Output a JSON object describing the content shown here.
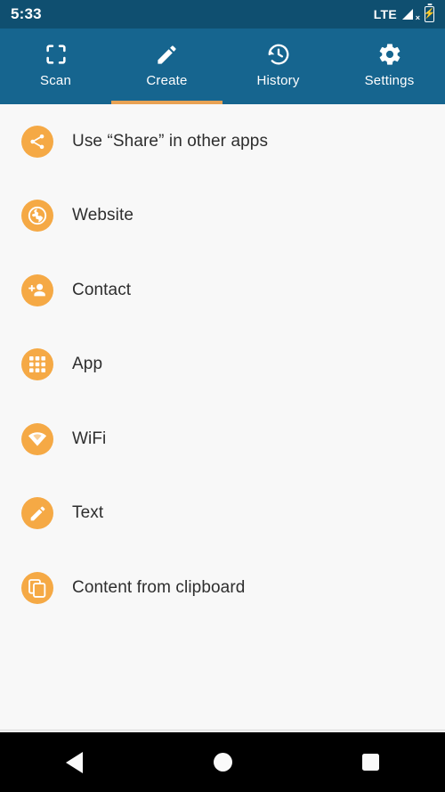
{
  "status_bar": {
    "time": "5:33",
    "network": "LTE",
    "signal_icon": "signal-no-service-icon",
    "battery_icon": "battery-charging-icon",
    "background_color": "#0f4f70"
  },
  "tab_bar": {
    "background_color": "#16658f",
    "indicator_color": "#e8a254",
    "active_tab": "Create",
    "tabs": [
      {
        "label": "Scan",
        "icon": "scan-frame-icon",
        "active": false
      },
      {
        "label": "Create",
        "icon": "pencil-icon",
        "active": true
      },
      {
        "label": "History",
        "icon": "history-clock-icon",
        "active": false
      },
      {
        "label": "Settings",
        "icon": "gear-icon",
        "active": false
      }
    ]
  },
  "list": {
    "accent_color": "#f5a945",
    "background_color": "#f8f8f8",
    "text_color": "#2e2e2e",
    "items": [
      {
        "label": "Use “Share” in other apps",
        "icon": "share-icon"
      },
      {
        "label": "Website",
        "icon": "globe-icon"
      },
      {
        "label": "Contact",
        "icon": "add-person-icon"
      },
      {
        "label": "App",
        "icon": "apps-grid-icon"
      },
      {
        "label": "WiFi",
        "icon": "wifi-icon"
      },
      {
        "label": "Text",
        "icon": "pencil-icon"
      },
      {
        "label": "Content from clipboard",
        "icon": "copy-clipboard-icon"
      }
    ]
  },
  "nav_bar": {
    "background_color": "#000000",
    "buttons": [
      {
        "name": "back",
        "icon": "triangle-back-icon"
      },
      {
        "name": "home",
        "icon": "circle-home-icon"
      },
      {
        "name": "recents",
        "icon": "square-recents-icon"
      }
    ]
  }
}
